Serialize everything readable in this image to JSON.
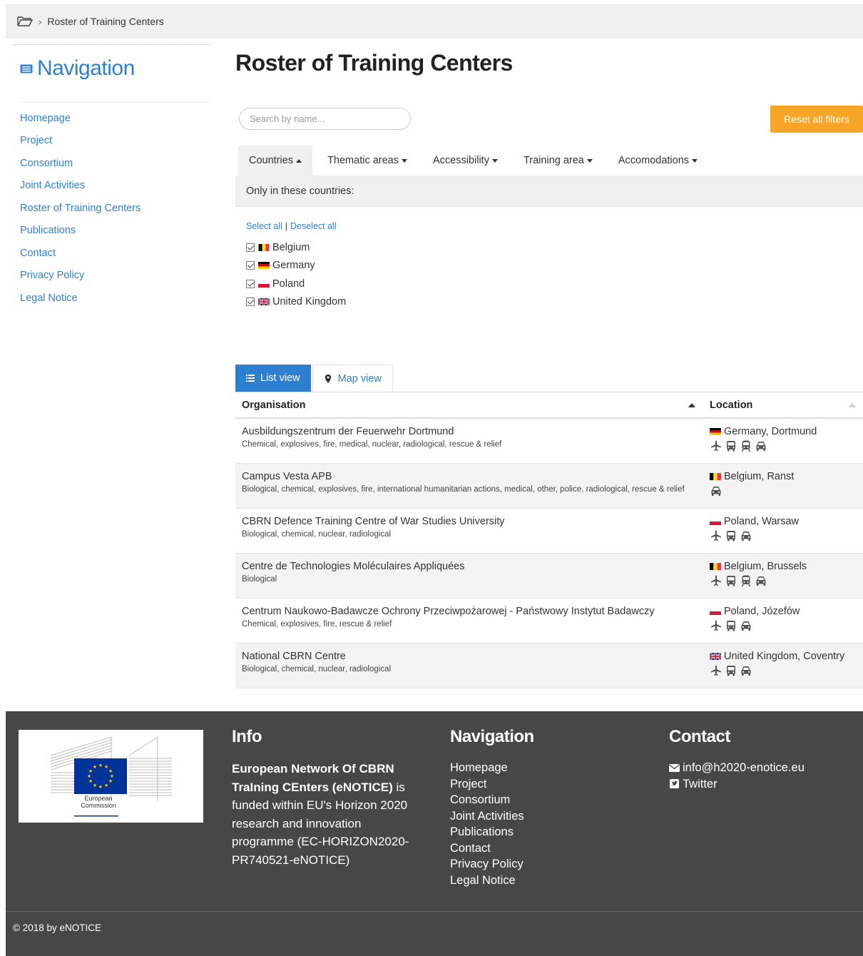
{
  "breadcrumb": {
    "current": "Roster of Training Centers"
  },
  "sidebar": {
    "title": "Navigation",
    "items": [
      {
        "label": "Homepage"
      },
      {
        "label": "Project"
      },
      {
        "label": "Consortium"
      },
      {
        "label": "Joint Activities"
      },
      {
        "label": "Roster of Training Centers"
      },
      {
        "label": "Publications"
      },
      {
        "label": "Contact"
      },
      {
        "label": "Privacy Policy"
      },
      {
        "label": "Legal Notice"
      }
    ]
  },
  "main": {
    "title": "Roster of Training Centers",
    "search_placeholder": "Search by name...",
    "reset_label": "Reset all filters",
    "filter_tabs": [
      {
        "label": "Countries"
      },
      {
        "label": "Thematic areas"
      },
      {
        "label": "Accessibility"
      },
      {
        "label": "Training area"
      },
      {
        "label": "Accomodations"
      }
    ],
    "countries_heading": "Only in these countries:",
    "select_all": "Select all",
    "deselect_all": "Deselect all",
    "countries": [
      {
        "name": "Belgium",
        "checked": true
      },
      {
        "name": "Germany",
        "checked": true
      },
      {
        "name": "Poland",
        "checked": true
      },
      {
        "name": "United Kingdom",
        "checked": true
      }
    ],
    "view_tabs": {
      "list": "List view",
      "map": "Map view"
    },
    "table": {
      "headers": {
        "organisation": "Organisation",
        "location": "Location"
      },
      "rows": [
        {
          "org": "Ausbildungszentrum der Feuerwehr Dortmund",
          "areas": "Chemical, explosives, fire, medical, nuclear, radiological, rescue & relief",
          "location": "Germany, Dortmund",
          "country": "germany",
          "access": [
            "plane-icon",
            "bus-icon",
            "train-icon",
            "car-icon"
          ]
        },
        {
          "org": "Campus Vesta APB",
          "areas": "Biological, chemical, explosives, fire, international humanitarian actions, medical, other, police, radiological, rescue & relief",
          "location": "Belgium, Ranst",
          "country": "belgium",
          "access": [
            "car-icon"
          ]
        },
        {
          "org": "CBRN Defence Training Centre of War Studies University",
          "areas": "Biological, chemical, nuclear, radiological",
          "location": "Poland, Warsaw",
          "country": "poland",
          "access": [
            "plane-icon",
            "bus-icon",
            "car-icon"
          ]
        },
        {
          "org": "Centre de Technologies Moléculaires Appliquées",
          "areas": "Biological",
          "location": "Belgium, Brussels",
          "country": "belgium",
          "access": [
            "plane-icon",
            "bus-icon",
            "train-icon",
            "car-icon"
          ]
        },
        {
          "org": "Centrum Naukowo-Badawcze Ochrony Przeciwpożarowej - Państwowy Instytut Badawczy",
          "areas": "Chemical, explosives, fire, rescue & relief",
          "location": "Poland, Józefów",
          "country": "poland",
          "access": [
            "plane-icon",
            "bus-icon",
            "car-icon"
          ]
        },
        {
          "org": "National CBRN Centre",
          "areas": "Biological, chemical, nuclear, radiological",
          "location": "United Kingdom, Coventry",
          "country": "uk",
          "access": [
            "plane-icon",
            "bus-icon",
            "car-icon"
          ]
        }
      ]
    }
  },
  "footer": {
    "logo_text": [
      "European",
      "Commission"
    ],
    "info": {
      "title": "Info",
      "bold_text": "European Network Of CBRN TraIning CEnters (eNOTICE)",
      "text": " is funded within EU's Horizon 2020 research and innovation programme (EC-HORIZON2020-PR740521-eNOTICE)"
    },
    "navigation": {
      "title": "Navigation",
      "items": [
        "Homepage",
        "Project",
        "Consortium",
        "Joint Activities",
        "Publications",
        "Contact",
        "Privacy Policy",
        "Legal Notice"
      ]
    },
    "contact": {
      "title": "Contact",
      "email": "info@h2020-enotice.eu",
      "twitter": "Twitter"
    },
    "copyright": "© 2018 by eNOTICE"
  },
  "colors": {
    "accent": "#2f7fd0",
    "reset": "#f7a527",
    "footer": "#474747"
  }
}
